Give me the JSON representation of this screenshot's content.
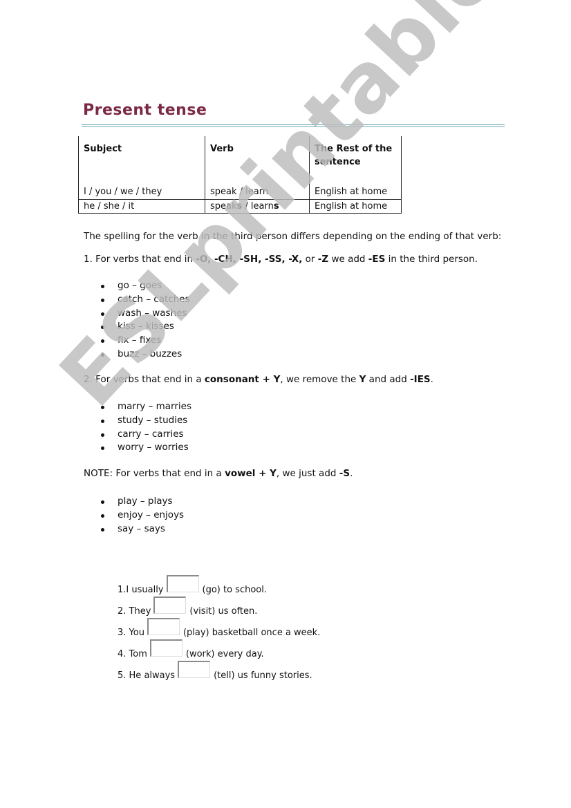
{
  "title": "Present tense",
  "colors": {
    "title": "#7b2a45",
    "rule": "#6fa8b8",
    "watermark": "#bdbdbd"
  },
  "watermark": "ESLprintables.com",
  "table": {
    "headers": [
      "Subject",
      "Verb",
      "The Rest of the sentence"
    ],
    "rows": [
      {
        "subject": "I / you / we / they",
        "verb_base": "speak / learn",
        "rest": "English at home"
      },
      {
        "subject": "he / she / it",
        "verb_parts": [
          "speak",
          "s",
          " / learn",
          "s"
        ],
        "rest": "English at home"
      }
    ]
  },
  "intro": "The spelling for the verb in the third person differs depending on the ending of that verb:",
  "rule1": {
    "prefix": "1. For verbs that end in ",
    "endings": "-O, -CH, -SH, -SS, -X,",
    "or": " or ",
    "z": "-Z",
    "mid": " we add ",
    "add": "-ES",
    "suffix": " in the third person.",
    "examples": [
      "go – goes",
      "catch – catches",
      "wash – washes",
      "kiss – kisses",
      "fix – fixes",
      "buzz – buzzes"
    ]
  },
  "rule2": {
    "prefix": "2. For verbs that end in a ",
    "cond": "consonant + Y",
    "mid": ", we remove the ",
    "y": "Y",
    "mid2": " and add ",
    "add": "-IES",
    "suffix": ".",
    "examples": [
      "marry – marries",
      "study – studies",
      "carry – carries",
      "worry – worries"
    ]
  },
  "note": {
    "label": "NOTE:",
    "prefix": " For verbs that end in a ",
    "cond": "vowel + Y",
    "mid": ", we just add ",
    "add": "-S",
    "suffix": ".",
    "examples": [
      "play – plays",
      "enjoy – enjoys",
      "say – says"
    ]
  },
  "exercises": [
    {
      "before": "1.I usually",
      "value": "",
      "after": "(go) to school."
    },
    {
      "before": "2. They",
      "value": "",
      "after": "(visit) us often."
    },
    {
      "before": "3. You",
      "value": "",
      "after": "(play) basketball once a week."
    },
    {
      "before": "4. Tom",
      "value": "",
      "after": "(work) every day."
    },
    {
      "before": "5. He always",
      "value": "",
      "after": "(tell) us funny stories."
    }
  ]
}
